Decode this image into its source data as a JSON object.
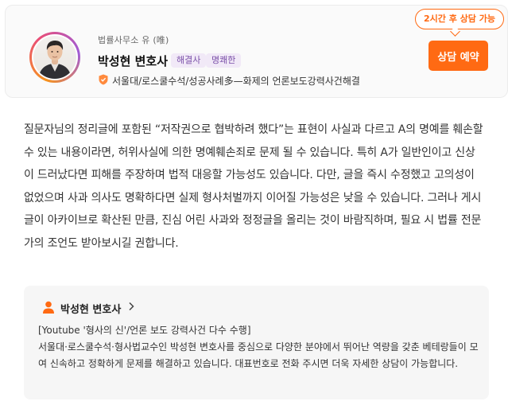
{
  "lawyer": {
    "firm": "법률사무소 유 (唯)",
    "name": "박성현 변호사",
    "tags": [
      "해결사",
      "명쾌한"
    ],
    "credentials": "서울대/로스쿨수석/성공사례多—화제의 언론보도강력사건해결"
  },
  "consult": {
    "availability": "2시간 후 상담 가능",
    "button_label": "상담 예약"
  },
  "answer": {
    "text": "질문자님의 정리글에 포함된 “저작권으로 협박하려 했다”는 표현이 사실과 다르고 A의 명예를 훼손할 수 있는 내용이라면, 허위사실에 의한 명예훼손죄로 문제 될 수 있습니다. 특히 A가 일반인이고 신상이 드러났다면 피해를 주장하며 법적 대응할 가능성도 있습니다. 다만, 글을 즉시 수정했고 고의성이 없었으며 사과 의사도 명확하다면 실제 형사처벌까지 이어질 가능성은 낮을 수 있습니다. 그러나 게시글이 아카이브로 확산된 만큼, 진심 어린 사과와 정정글을 올리는 것이 바람직하며, 필요 시 법률 전문가의 조언도 받아보시길 권합니다."
  },
  "profile_box": {
    "name": "박성현 변호사",
    "headline": "[Youtube '형사의 신'/언론 보도 강력사건 다수 수행]",
    "description": "서울대·로스쿨수석·형사법교수인 박성현 변호사를 중심으로 다양한 분야에서 뛰어난 역량을 갖춘 베테랑들이 모여 신속하고 정확하게 문제를 해결하고 있습니다. 대표번호로 전화 주시면 더욱 자세한 상담이 가능합니다."
  },
  "colors": {
    "accent": "#ff6a13",
    "tag_bg": "#f1e9f7",
    "tag_text": "#7a4fa8"
  },
  "icons": [
    "lawyer-avatar",
    "credential-badge-icon",
    "person-icon",
    "chevron-right-icon"
  ]
}
